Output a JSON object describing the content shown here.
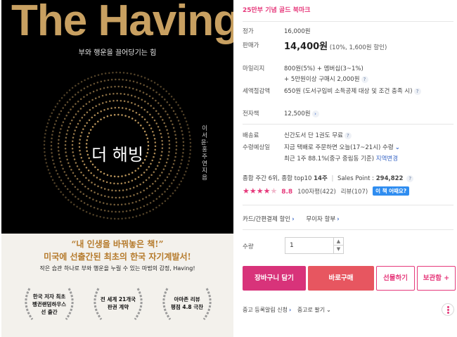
{
  "cover": {
    "title": "The Having",
    "subtitle": "부와 행운을 끌어당기는 힘",
    "korean_title": "더 해빙",
    "author": "이서윤·홍주연 지음",
    "quote1": "“내 인생을 바꿔놓은 책!”",
    "quote2": "미국에 선출간된 최초의 한국 자기계발서!",
    "quote3": "작은 습관 하나로 부와 행운을 누릴 수 있는 마법의 감정, Having!",
    "awards": [
      {
        "line1": "한국 저자 최초",
        "line2": "펭귄랜덤하우스",
        "line3": "선 출간"
      },
      {
        "line1": "전 세계 21개국",
        "line2": "판권 계약",
        "line3": ""
      },
      {
        "line1": "아마존 리뷰",
        "line2": "평점 4.8 극찬",
        "line3": ""
      }
    ],
    "colors": {
      "gold": "#c8a061",
      "quote": "#b57a2b"
    }
  },
  "promo": "25만부 기념 골드 북마크",
  "price": {
    "list_label": "정가",
    "list_value": "16,000원",
    "sale_label": "판매가",
    "sale_value": "14,400원",
    "sale_note": "(10%, 1,600원 할인)"
  },
  "mileage": {
    "label": "마일리지",
    "line1": "800원(5%) + 멤버십(3~1%)",
    "line2": "+ 5만원이상 구매시 2,000원"
  },
  "tax": {
    "label": "세액절감액",
    "value": "650원 (도서구입비 소득공제 대상 및 조건 충족 시)"
  },
  "ebook": {
    "label": "전자책",
    "value": "12,500원"
  },
  "shipping": {
    "fee_label": "배송료",
    "fee_value": "신간도서 단 1권도 무료",
    "eta_label": "수령예상일",
    "eta_value": "지금 택배로 주문하면 오늘(17~21시) 수령",
    "eta_note_prefix": "최근 1주 88.1%(중구 중림동 기준)",
    "eta_link": "지역변경"
  },
  "ranking": {
    "text_prefix": "종합 주간 6위, 종합 top10",
    "weeks": "14주",
    "sales_label": "Sales Point :",
    "sales_value": "294,822"
  },
  "review": {
    "rating": "8.8",
    "count100": "100자평(422)",
    "reviews": "리뷰(107)",
    "badge": "이 책 어때요?"
  },
  "payment_link": "카드/간편결제 할인",
  "interest_free": "무이자 할부",
  "quantity": {
    "label": "수량",
    "value": "1"
  },
  "buttons": {
    "cart": "장바구니 담기",
    "buy": "바로구매",
    "gift": "선물하기",
    "keep": "보관함 +"
  },
  "footer": {
    "alert": "중고 등록알림 신청",
    "used_sell": "중고로 팔기"
  },
  "colors": {
    "accent": "#e6397b",
    "buy": "#e75660",
    "cart": "#d8337a",
    "link": "#3a67c6"
  }
}
